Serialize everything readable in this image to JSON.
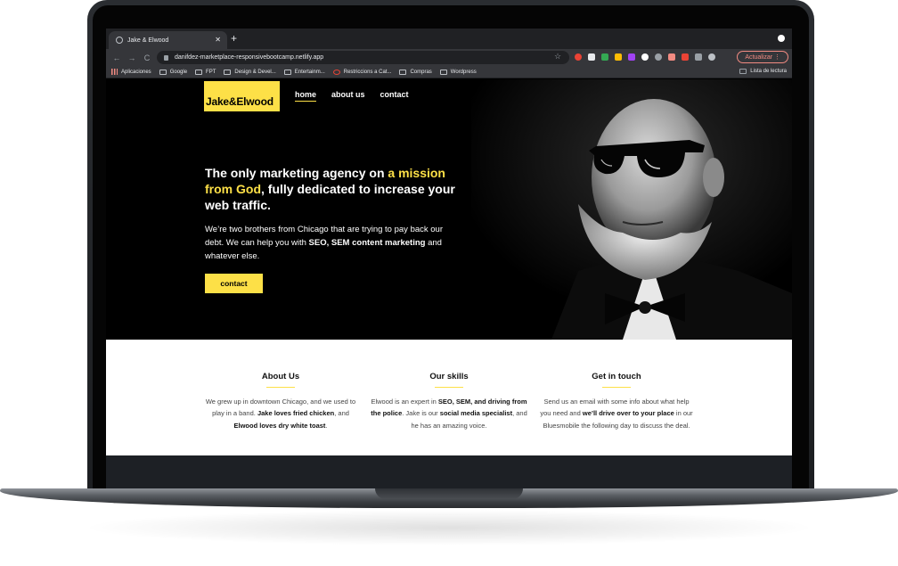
{
  "browser": {
    "tab_title": "Jake & Elwood",
    "tab_close": "✕",
    "new_tab": "+",
    "nav_back": "←",
    "nav_forward": "→",
    "nav_reload": "C",
    "url": "danifdez-marketplace-responsivebootcamp.netlify.app",
    "bookmark_star": "☆",
    "update_button": "Actualizar ⋮",
    "bookmarks": [
      "Aplicaciones",
      "Google",
      "FPT",
      "Design & Devel...",
      "Entertainm...",
      "Restriccions a Cat...",
      "Compras",
      "Wordpress"
    ],
    "reading_list": "Lista de lectura"
  },
  "site": {
    "logo": "Jake&Elwood",
    "nav": [
      "home",
      "about us",
      "contact"
    ],
    "headline_part1": "The only marketing agency on ",
    "headline_highlight": "a mission from God",
    "headline_part2": ", fully dedicated to increase your web traffic.",
    "sub_part1": "We’re two brothers from Chicago that are trying to pay back our debt. We can help you with ",
    "sub_bold": "SEO, SEM content marketing",
    "sub_part2": " and whatever else.",
    "cta": "contact"
  },
  "sections": {
    "about": {
      "title": "About Us",
      "t1": "We grew up in downtown Chicago, and we used to play in a band. ",
      "b1": "Jake loves fried chicken",
      "t2": ", and ",
      "b2": "Elwood loves dry white toast",
      "t3": "."
    },
    "skills": {
      "title": "Our skills",
      "t1": "Elwood is an expert in ",
      "b1": "SEO, SEM, and driving from the police",
      "t2": ". Jake is our ",
      "b2": "social media specialist",
      "t3": ", and he has an amazing voice."
    },
    "contact": {
      "title": "Get in touch",
      "t1": "Send us an email with some info about what help you need and ",
      "b1": "we’ll drive over to your place",
      "t2": " in our Bluesmobile the following day to discuss the deal."
    }
  },
  "colors": {
    "accent": "#fde047",
    "hero_bg": "#000000",
    "chrome_dark": "#202124",
    "chrome_toolbar": "#35363a"
  }
}
